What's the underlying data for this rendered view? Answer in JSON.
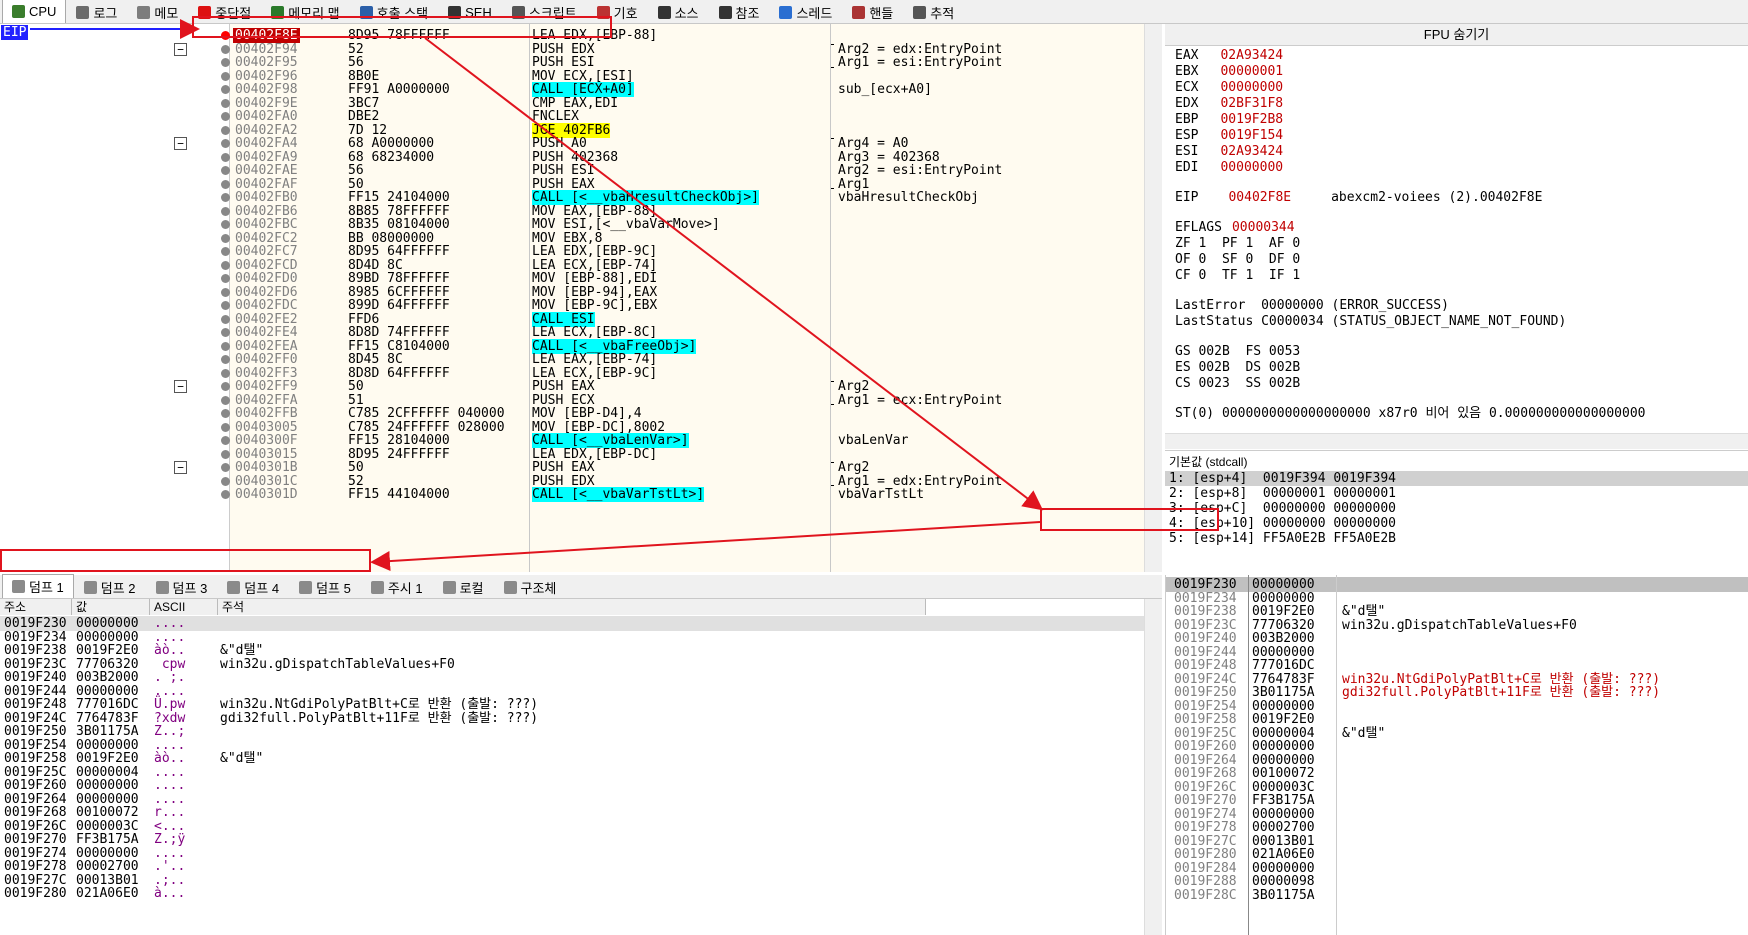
{
  "top_tabs": [
    {
      "label": "CPU",
      "icon": "cpu-icon",
      "color": "#3a7d2c"
    },
    {
      "label": "로그",
      "icon": "log-icon",
      "color": "#6b6b6b"
    },
    {
      "label": "메모",
      "icon": "notes-icon",
      "color": "#7d7d7d"
    },
    {
      "label": "중단점",
      "icon": "breakpoint-icon",
      "color": "#d11"
    },
    {
      "label": "메모리 맵",
      "icon": "memory-map-icon",
      "color": "#2a7a2a"
    },
    {
      "label": "호출 스택",
      "icon": "call-stack-icon",
      "color": "#2b5fa8"
    },
    {
      "label": "SEH",
      "icon": "seh-icon",
      "color": "#333"
    },
    {
      "label": "스크립트",
      "icon": "script-icon",
      "color": "#555"
    },
    {
      "label": "기호",
      "icon": "symbols-icon",
      "color": "#b33"
    },
    {
      "label": "소스",
      "icon": "source-icon",
      "color": "#333"
    },
    {
      "label": "참조",
      "icon": "references-icon",
      "color": "#333"
    },
    {
      "label": "스레드",
      "icon": "threads-icon",
      "color": "#2a6ed1"
    },
    {
      "label": "핸들",
      "icon": "handles-icon",
      "color": "#a33"
    },
    {
      "label": "추적",
      "icon": "trace-icon",
      "color": "#555"
    }
  ],
  "eip_label": "EIP",
  "disasm": [
    {
      "addr": "00402F8E",
      "bytes": "8D95 78FFFFFF",
      "asm": "LEA EDX,[EBP-88]",
      "comment": ""
    },
    {
      "addr": "00402F94",
      "bytes": "52",
      "asm": "PUSH EDX",
      "comment": "Arg2 = edx:EntryPoint"
    },
    {
      "addr": "00402F95",
      "bytes": "56",
      "asm": "PUSH ESI",
      "comment": "Arg1 = esi:EntryPoint"
    },
    {
      "addr": "00402F96",
      "bytes": "8B0E",
      "asm": "MOV ECX,[ESI]",
      "comment": ""
    },
    {
      "addr": "00402F98",
      "bytes": "FF91 A0000000",
      "asm": "CALL [ECX+A0]",
      "comment": "sub_[ecx+A0]"
    },
    {
      "addr": "00402F9E",
      "bytes": "3BC7",
      "asm": "CMP EAX,EDI",
      "comment": ""
    },
    {
      "addr": "00402FA0",
      "bytes": "DBE2",
      "asm": "FNCLEX",
      "comment": ""
    },
    {
      "addr": "00402FA2",
      "bytes": "7D 12",
      "asm": "JGE 402FB6",
      "comment": ""
    },
    {
      "addr": "00402FA4",
      "bytes": "68 A0000000",
      "asm": "PUSH A0",
      "comment": "Arg4 = A0"
    },
    {
      "addr": "00402FA9",
      "bytes": "68 68234000",
      "asm": "PUSH 402368",
      "comment": "Arg3 = 402368"
    },
    {
      "addr": "00402FAE",
      "bytes": "56",
      "asm": "PUSH ESI",
      "comment": "Arg2 = esi:EntryPoint"
    },
    {
      "addr": "00402FAF",
      "bytes": "50",
      "asm": "PUSH EAX",
      "comment": "Arg1"
    },
    {
      "addr": "00402FB0",
      "bytes": "FF15 24104000",
      "asm": "CALL [<__vbaHresultCheckObj>]",
      "comment": "vbaHresultCheckObj"
    },
    {
      "addr": "00402FB6",
      "bytes": "8B85 78FFFFFF",
      "asm": "MOV EAX,[EBP-88]",
      "comment": ""
    },
    {
      "addr": "00402FBC",
      "bytes": "8B35 08104000",
      "asm": "MOV ESI,[<__vbaVarMove>]",
      "comment": ""
    },
    {
      "addr": "00402FC2",
      "bytes": "BB 08000000",
      "asm": "MOV EBX,8",
      "comment": ""
    },
    {
      "addr": "00402FC7",
      "bytes": "8D95 64FFFFFF",
      "asm": "LEA EDX,[EBP-9C]",
      "comment": ""
    },
    {
      "addr": "00402FCD",
      "bytes": "8D4D 8C",
      "asm": "LEA ECX,[EBP-74]",
      "comment": ""
    },
    {
      "addr": "00402FD0",
      "bytes": "89BD 78FFFFFF",
      "asm": "MOV [EBP-88],EDI",
      "comment": ""
    },
    {
      "addr": "00402FD6",
      "bytes": "8985 6CFFFFFF",
      "asm": "MOV [EBP-94],EAX",
      "comment": ""
    },
    {
      "addr": "00402FDC",
      "bytes": "899D 64FFFFFF",
      "asm": "MOV [EBP-9C],EBX",
      "comment": ""
    },
    {
      "addr": "00402FE2",
      "bytes": "FFD6",
      "asm": "CALL ESI",
      "comment": ""
    },
    {
      "addr": "00402FE4",
      "bytes": "8D8D 74FFFFFF",
      "asm": "LEA ECX,[EBP-8C]",
      "comment": ""
    },
    {
      "addr": "00402FEA",
      "bytes": "FF15 C8104000",
      "asm": "CALL [<__vbaFreeObj>]",
      "comment": ""
    },
    {
      "addr": "00402FF0",
      "bytes": "8D45 8C",
      "asm": "LEA EAX,[EBP-74]",
      "comment": ""
    },
    {
      "addr": "00402FF3",
      "bytes": "8D8D 64FFFFFF",
      "asm": "LEA ECX,[EBP-9C]",
      "comment": ""
    },
    {
      "addr": "00402FF9",
      "bytes": "50",
      "asm": "PUSH EAX",
      "comment": "Arg2"
    },
    {
      "addr": "00402FFA",
      "bytes": "51",
      "asm": "PUSH ECX",
      "comment": "Arg1 = ecx:EntryPoint"
    },
    {
      "addr": "00402FFB",
      "bytes": "C785 2CFFFFFF 040000",
      "asm": "MOV [EBP-D4],4",
      "comment": ""
    },
    {
      "addr": "00403005",
      "bytes": "C785 24FFFFFF 028000",
      "asm": "MOV [EBP-DC],8002",
      "comment": ""
    },
    {
      "addr": "0040300F",
      "bytes": "FF15 28104000",
      "asm": "CALL [<__vbaLenVar>]",
      "comment": "vbaLenVar"
    },
    {
      "addr": "00403015",
      "bytes": "8D95 24FFFFFF",
      "asm": "LEA EDX,[EBP-DC]",
      "comment": ""
    },
    {
      "addr": "0040301B",
      "bytes": "50",
      "asm": "PUSH EAX",
      "comment": "Arg2"
    },
    {
      "addr": "0040301C",
      "bytes": "52",
      "asm": "PUSH EDX",
      "comment": "Arg1 = edx:EntryPoint"
    },
    {
      "addr": "0040301D",
      "bytes": "FF15 44104000",
      "asm": "CALL [<__vbaVarTstLt>]",
      "comment": "vbaVarTstLt"
    }
  ],
  "registers": {
    "header": "FPU 숨기기",
    "gp": [
      [
        "EAX",
        "02A93424"
      ],
      [
        "EBX",
        "00000001"
      ],
      [
        "ECX",
        "00000000"
      ],
      [
        "EDX",
        "02BF31F8"
      ],
      [
        "EBP",
        "0019F2B8"
      ],
      [
        "ESP",
        "0019F154"
      ],
      [
        "ESI",
        "02A93424"
      ],
      [
        "EDI",
        "00000000"
      ]
    ],
    "eip_line": {
      "name": "EIP",
      "value": "00402F8E",
      "desc": "abexcm2-voiees (2).00402F8E"
    },
    "eflags": {
      "name": "EFLAGS",
      "value": "00000344"
    },
    "flag_lines": [
      "ZF 1  PF 1  AF 0",
      "OF 0  SF 0  DF 0",
      "CF 0  TF 1  IF 1"
    ],
    "last_error": "LastError  00000000 (ERROR_SUCCESS)",
    "last_status": "LastStatus C0000034 (STATUS_OBJECT_NAME_NOT_FOUND)",
    "seg_lines": [
      "GS 002B  FS 0053",
      "ES 002B  DS 002B",
      "CS 0023  SS 002B"
    ],
    "st0": "ST(0) 0000000000000000000 x87r0 비어 있음 0.000000000000000000"
  },
  "call_conv": {
    "label": "기본값 (stdcall)",
    "args": [
      "1: [esp+4]  0019F394 0019F394",
      "2: [esp+8]  00000001 00000001",
      "3: [esp+C]  00000000 00000000",
      "4: [esp+10] 00000000 00000000",
      "5: [esp+14] FF5A0E2B FF5A0E2B"
    ]
  },
  "dump_tabs": [
    {
      "label": "덤프 1",
      "icon": "dump-icon"
    },
    {
      "label": "덤프 2",
      "icon": "dump-icon"
    },
    {
      "label": "덤프 3",
      "icon": "dump-icon"
    },
    {
      "label": "덤프 4",
      "icon": "dump-icon"
    },
    {
      "label": "덤프 5",
      "icon": "dump-icon"
    },
    {
      "label": "주시 1",
      "icon": "watch-icon"
    },
    {
      "label": "로컬",
      "icon": "locals-icon"
    },
    {
      "label": "구조체",
      "icon": "struct-icon"
    }
  ],
  "dump": {
    "headers": [
      "주소",
      "값",
      "ASCII",
      "주석"
    ],
    "rows": [
      [
        "0019F230",
        "00000000",
        "....",
        ""
      ],
      [
        "0019F234",
        "00000000",
        "....",
        ""
      ],
      [
        "0019F238",
        "0019F2E0",
        "àò..",
        "&\"d탤\""
      ],
      [
        "0019F23C",
        "77706320",
        " cpw",
        "win32u.gDispatchTableValues+F0"
      ],
      [
        "0019F240",
        "003B2000",
        ". ;.",
        ""
      ],
      [
        "0019F244",
        "00000000",
        "....",
        ""
      ],
      [
        "0019F248",
        "777016DC",
        "Ü.pw",
        "win32u.NtGdiPolyPatBlt+C로 반환 (출발: ???)"
      ],
      [
        "0019F24C",
        "7764783F",
        "?xdw",
        "gdi32full.PolyPatBlt+11F로 반환 (출발: ???)"
      ],
      [
        "0019F250",
        "3B01175A",
        "Z..;",
        ""
      ],
      [
        "0019F254",
        "00000000",
        "....",
        ""
      ],
      [
        "0019F258",
        "0019F2E0",
        "àò..",
        "&\"d탤\""
      ],
      [
        "0019F25C",
        "00000004",
        "....",
        ""
      ],
      [
        "0019F260",
        "00000000",
        "....",
        ""
      ],
      [
        "0019F264",
        "00000000",
        "....",
        ""
      ],
      [
        "0019F268",
        "00100072",
        "r...",
        ""
      ],
      [
        "0019F26C",
        "0000003C",
        "<...",
        ""
      ],
      [
        "0019F270",
        "FF3B175A",
        "Z.;ÿ",
        ""
      ],
      [
        "0019F274",
        "00000000",
        "....",
        ""
      ],
      [
        "0019F278",
        "00002700",
        ".'..",
        ""
      ],
      [
        "0019F27C",
        "00013B01",
        ".;..",
        ""
      ],
      [
        "0019F280",
        "021A06E0",
        "à...",
        ""
      ]
    ]
  },
  "stack": {
    "rows": [
      [
        "0019F230",
        "00000000",
        ""
      ],
      [
        "0019F234",
        "00000000",
        ""
      ],
      [
        "0019F238",
        "0019F2E0",
        "&\"d탤\""
      ],
      [
        "0019F23C",
        "77706320",
        "win32u.gDispatchTableValues+F0"
      ],
      [
        "0019F240",
        "003B2000",
        ""
      ],
      [
        "0019F244",
        "00000000",
        ""
      ],
      [
        "0019F248",
        "777016DC",
        ""
      ],
      [
        "0019F24C",
        "7764783F",
        "win32u.NtGdiPolyPatBlt+C로 반환 (출발: ???)"
      ],
      [
        "0019F250",
        "3B01175A",
        "gdi32full.PolyPatBlt+11F로 반환 (출발: ???)"
      ],
      [
        "0019F254",
        "00000000",
        ""
      ],
      [
        "0019F258",
        "0019F2E0",
        ""
      ],
      [
        "0019F25C",
        "00000004",
        "&\"d탤\""
      ],
      [
        "0019F260",
        "00000000",
        ""
      ],
      [
        "0019F264",
        "00000000",
        ""
      ],
      [
        "0019F268",
        "00100072",
        ""
      ],
      [
        "0019F26C",
        "0000003C",
        ""
      ],
      [
        "0019F270",
        "FF3B175A",
        ""
      ],
      [
        "0019F274",
        "00000000",
        ""
      ],
      [
        "0019F278",
        "00002700",
        ""
      ],
      [
        "0019F27C",
        "00013B01",
        ""
      ],
      [
        "0019F280",
        "021A06E0",
        ""
      ],
      [
        "0019F284",
        "00000000",
        ""
      ],
      [
        "0019F288",
        "00000098",
        ""
      ],
      [
        "0019F28C",
        "3B01175A",
        ""
      ]
    ]
  },
  "colors": {
    "accent_red": "#e0141e",
    "eip_blue": "#2121ff",
    "call_yellow": "#ffff00",
    "cyan": "#00ffff"
  }
}
